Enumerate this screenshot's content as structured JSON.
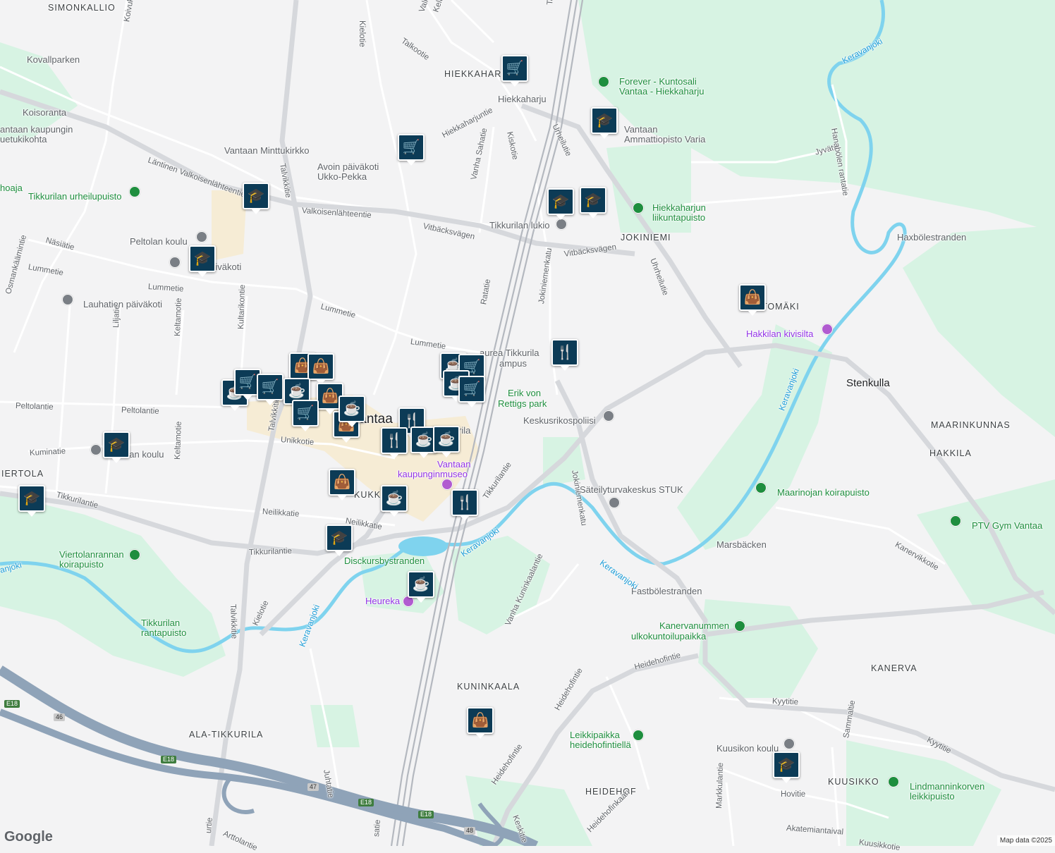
{
  "map": {
    "attribution": "Map data ©2025",
    "logo": "Google",
    "area_labels": [
      {
        "text": "SIMONKALLIO"
      },
      {
        "text": "HIEKKAHARJU"
      },
      {
        "text": "JOKINIEMI"
      },
      {
        "text": "TOMÄKI"
      },
      {
        "text": "MAARINKUNNAS"
      },
      {
        "text": "HAKKILA"
      },
      {
        "text": "IERTOLA"
      },
      {
        "text": "KUKKOKO"
      },
      {
        "text": "KUNINKAALA"
      },
      {
        "text": "ALA-TIKKURILA"
      },
      {
        "text": "HEIDEHOF"
      },
      {
        "text": "KUUSIKKO"
      },
      {
        "text": "KANERVA"
      },
      {
        "text": "Stenkulla"
      },
      {
        "text": "Vantaa"
      }
    ],
    "place_labels": [
      {
        "text": "Kovallparken"
      },
      {
        "text": "Koisoranta"
      },
      {
        "text": "antaan kaupungin"
      },
      {
        "text": "uetukikohta"
      },
      {
        "text": "Vantaan Minttukirkko"
      },
      {
        "text": "Avoin päiväkoti"
      },
      {
        "text": "Ukko-Pekka"
      },
      {
        "text": "Tikkurilan urheilupuisto"
      },
      {
        "text": "Peltolan koulu"
      },
      {
        "text": "lan päiväkoti"
      },
      {
        "text": "Lauhatien päiväkoti"
      },
      {
        "text": "Forever - Kuntosali"
      },
      {
        "text": "Vantaa - Hiekkaharju"
      },
      {
        "text": "Vantaan"
      },
      {
        "text": "Ammattiopisto Varia"
      },
      {
        "text": "Hiekkaharjun"
      },
      {
        "text": "liikuntapuisto"
      },
      {
        "text": "Tikkurilan lukio"
      },
      {
        "text": "Hakkilan kivisilta"
      },
      {
        "text": "Haxbölestranden"
      },
      {
        "text": "aurea Tikkurila"
      },
      {
        "text": "ampus"
      },
      {
        "text": "Erik von"
      },
      {
        "text": "Rettigs park"
      },
      {
        "text": "Keskusrikospoliisi"
      },
      {
        "text": "Säteilyturvakeskus STUK"
      },
      {
        "text": "Maarinojan koirapuisto"
      },
      {
        "text": "PTV Gym Vantaa"
      },
      {
        "text": "Marsbäcken"
      },
      {
        "text": "Fastbölestranden"
      },
      {
        "text": "Kanervanummen"
      },
      {
        "text": "ulkokuntoilupaikka"
      },
      {
        "text": "Vantaan"
      },
      {
        "text": "kaupunginmuseo"
      },
      {
        "text": "Disckursbystranden"
      },
      {
        "text": "Heureka"
      },
      {
        "text": "Viertolanrannan"
      },
      {
        "text": "koirapuisto"
      },
      {
        "text": "Tikkurilan"
      },
      {
        "text": "rantapuisto"
      },
      {
        "text": "ertolan koulu"
      },
      {
        "text": "Leikkipaikka"
      },
      {
        "text": "heidehofintiellä"
      },
      {
        "text": "Kuusikon koulu"
      },
      {
        "text": "Lindmanninkorven"
      },
      {
        "text": "leikkipuisto"
      },
      {
        "text": "Hiekkaharju"
      },
      {
        "text": "rila"
      },
      {
        "text": "hoaja"
      }
    ],
    "road_labels": [
      {
        "text": "Koivukyläntie"
      },
      {
        "text": "Talkootie"
      },
      {
        "text": "Keltavuokontie"
      },
      {
        "text": "Valkovuokontie"
      },
      {
        "text": "Kielotie"
      },
      {
        "text": "Läntinen Valkoisenlähteentie"
      },
      {
        "text": "Valkoisenlähteentie"
      },
      {
        "text": "Talvikkitie"
      },
      {
        "text": "Hiekkaharjuntie"
      },
      {
        "text": "Kiskotie"
      },
      {
        "text": "Vanha Sahatie"
      },
      {
        "text": "Urheilutie"
      },
      {
        "text": "Vitbäcksvägen"
      },
      {
        "text": "Vitbäcksvägen"
      },
      {
        "text": "Jyvätie"
      },
      {
        "text": "Hanabölen rantatie"
      },
      {
        "text": "Näsiätie"
      },
      {
        "text": "Lummetie"
      },
      {
        "text": "Lummetie"
      },
      {
        "text": "Lummetie"
      },
      {
        "text": "Lummetie"
      },
      {
        "text": "Osmankäämintie"
      },
      {
        "text": "Kultarikontie"
      },
      {
        "text": "Keltamotie"
      },
      {
        "text": "Liljatie"
      },
      {
        "text": "Ratatie"
      },
      {
        "text": "Jokiniemenkatu"
      },
      {
        "text": "Uhrheilutie"
      },
      {
        "text": "Peltolantie"
      },
      {
        "text": "Peltolantie"
      },
      {
        "text": "Unikkotie"
      },
      {
        "text": "Kuminatie"
      },
      {
        "text": "Keltamotie"
      },
      {
        "text": "Tikkurilantie"
      },
      {
        "text": "Neilikkatie"
      },
      {
        "text": "Neilikkatie"
      },
      {
        "text": "Tikkurilantie"
      },
      {
        "text": "Tikkurilantie"
      },
      {
        "text": "Talvikkitie"
      },
      {
        "text": "Kielotie"
      },
      {
        "text": "Jokiniemenkatu"
      },
      {
        "text": "Kanervikkotie"
      },
      {
        "text": "Vanha Kuninkaalantie"
      },
      {
        "text": "Heidehofintie"
      },
      {
        "text": "Heidehofintie"
      },
      {
        "text": "Heidehofintie"
      },
      {
        "text": "Kyytitie"
      },
      {
        "text": "Kyytitie"
      },
      {
        "text": "Juhtatie"
      },
      {
        "text": "Arttolantie"
      },
      {
        "text": "Keskitie"
      },
      {
        "text": "Heidehofinkaari"
      },
      {
        "text": "Markkulantie"
      },
      {
        "text": "Sammaltie"
      },
      {
        "text": "Hovitie"
      },
      {
        "text": "Akatemiantaival"
      },
      {
        "text": "Kuusikkotie"
      },
      {
        "text": "Ratatie"
      },
      {
        "text": "Talvikkitie"
      },
      {
        "text": "urtie"
      },
      {
        "text": "satie"
      },
      {
        "text": "Tarhi"
      }
    ],
    "water_labels": [
      {
        "text": "Keravanjoki"
      },
      {
        "text": "Keravanjoki"
      },
      {
        "text": "Keravanjoki"
      },
      {
        "text": "Keravanjoki"
      },
      {
        "text": "Keravanjoki"
      },
      {
        "text": "Keravanjoki"
      },
      {
        "text": "anjoki"
      }
    ],
    "shields": [
      {
        "text": "E18"
      },
      {
        "text": "46"
      },
      {
        "text": "E18"
      },
      {
        "text": "47"
      },
      {
        "text": "E18"
      },
      {
        "text": "E18"
      },
      {
        "text": "48"
      }
    ],
    "markers": [
      {
        "type": "shopping-cart"
      },
      {
        "type": "shopping-cart"
      },
      {
        "type": "school"
      },
      {
        "type": "school"
      },
      {
        "type": "school"
      },
      {
        "type": "school"
      },
      {
        "type": "school"
      },
      {
        "type": "shopping-bag"
      },
      {
        "type": "restaurant"
      },
      {
        "type": "coffee"
      },
      {
        "type": "shopping-cart"
      },
      {
        "type": "shopping-cart"
      },
      {
        "type": "shopping-bag"
      },
      {
        "type": "shopping-bag"
      },
      {
        "type": "coffee"
      },
      {
        "type": "shopping-bag"
      },
      {
        "type": "shopping-cart"
      },
      {
        "type": "shopping-bag"
      },
      {
        "type": "coffee"
      },
      {
        "type": "coffee"
      },
      {
        "type": "shopping-cart"
      },
      {
        "type": "coffee"
      },
      {
        "type": "restaurant"
      },
      {
        "type": "restaurant"
      },
      {
        "type": "coffee"
      },
      {
        "type": "coffee"
      },
      {
        "type": "shopping-cart"
      },
      {
        "type": "shopping-bag"
      },
      {
        "type": "coffee"
      },
      {
        "type": "restaurant"
      },
      {
        "type": "school"
      },
      {
        "type": "coffee"
      },
      {
        "type": "school"
      },
      {
        "type": "school"
      },
      {
        "type": "shopping-bag"
      },
      {
        "type": "school"
      }
    ]
  }
}
